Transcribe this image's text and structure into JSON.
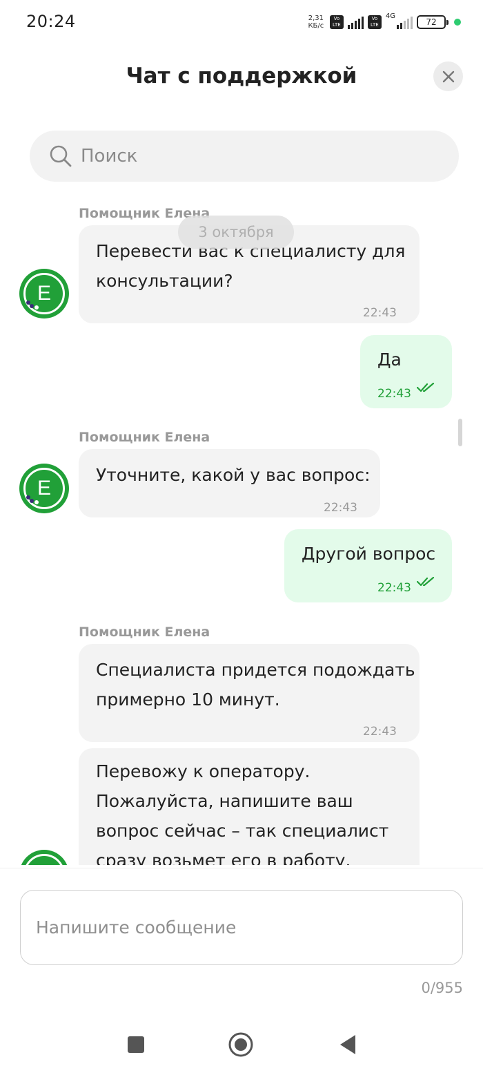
{
  "status_bar": {
    "time": "20:24",
    "network_speed": "2,31\nКБ/с",
    "network_type": "4G",
    "battery": "72",
    "volte_label": "Vo\nLTE"
  },
  "header": {
    "title": "Чат с поддержкой",
    "close_icon": "close-icon"
  },
  "search": {
    "placeholder": "Поиск",
    "icon": "search-icon"
  },
  "chat": {
    "date_chip": "3 октября",
    "messages": [
      {
        "direction": "in",
        "sender": "Помощник Елена",
        "lines": [
          "Перевести вас к специалисту для",
          "консультации?"
        ],
        "time": "22:43",
        "avatar_letter": "E"
      },
      {
        "direction": "out",
        "lines": [
          "Да"
        ],
        "time": "22:43",
        "status": "read"
      },
      {
        "direction": "in",
        "sender": "Помощник Елена",
        "lines": [
          "Уточните, какой у вас вопрос:"
        ],
        "time": "22:43",
        "avatar_letter": "E"
      },
      {
        "direction": "out",
        "lines": [
          "Другой вопрос"
        ],
        "time": "22:43",
        "status": "read"
      },
      {
        "direction": "in",
        "sender": "Помощник Елена",
        "lines": [
          "Специалиста придется подождать",
          "примерно 10 минут."
        ],
        "time": "22:43"
      },
      {
        "direction": "in",
        "lines": [
          "Перевожу к оператору.",
          "Пожалуйста, напишите ваш",
          "вопрос сейчас – так специалист",
          "сразу возьмет его в работу."
        ],
        "avatar_letter": "E"
      }
    ]
  },
  "composer": {
    "placeholder": "Напишите сообщение",
    "counter": "0/955"
  },
  "colors": {
    "accent": "#21a038",
    "incoming_bubble": "#f3f3f3",
    "outgoing_bubble": "#e3fbea"
  },
  "nav_bar": {
    "icons": [
      "recents-icon",
      "home-icon",
      "back-icon"
    ]
  }
}
